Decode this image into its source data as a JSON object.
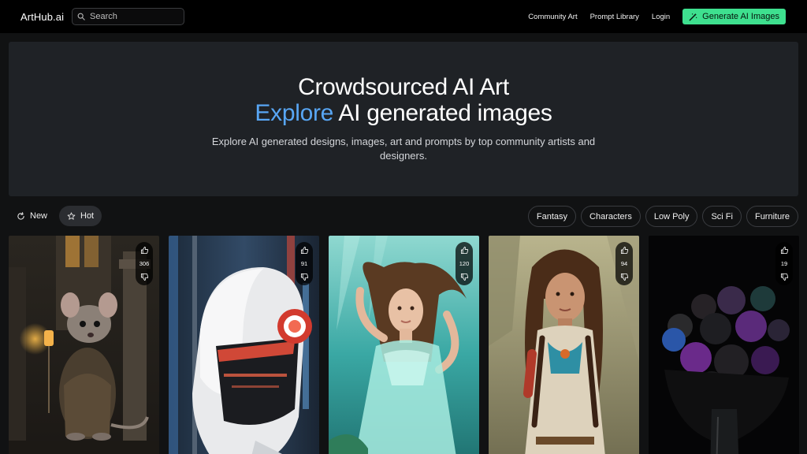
{
  "nav": {
    "logo": "ArtHub.ai",
    "search_placeholder": "Search",
    "links": [
      "Community Art",
      "Prompt Library",
      "Login"
    ],
    "cta": "Generate AI Images"
  },
  "hero": {
    "title": "Crowdsourced AI Art",
    "subtitle_accent": "Explore",
    "subtitle_rest": " AI generated images",
    "description": "Explore AI generated designs, images, art and prompts by top community artists and designers."
  },
  "sort": {
    "new_label": "New",
    "hot_label": "Hot",
    "active": "Hot"
  },
  "categories": [
    "Fantasy",
    "Characters",
    "Low Poly",
    "Sci Fi",
    "Furniture"
  ],
  "gallery": [
    {
      "subject": "mouse-wizard",
      "votes": "306"
    },
    {
      "subject": "robot-helmet",
      "votes": "91"
    },
    {
      "subject": "underwater-woman",
      "votes": "120"
    },
    {
      "subject": "braided-woman",
      "votes": "94"
    },
    {
      "subject": "dark-roses",
      "votes": "19"
    }
  ],
  "colors": {
    "accent_blue": "#58a6f4",
    "cta_green": "#3ee08f",
    "nav_bg": "#000000",
    "page_bg": "#111213",
    "hero_bg": "#1f2226"
  },
  "icons": {
    "search": "search-icon",
    "cta": "magic-wand-icon",
    "new": "refresh-icon",
    "hot": "star-icon",
    "upvote": "thumbs-up-icon",
    "downvote": "thumbs-down-icon"
  }
}
